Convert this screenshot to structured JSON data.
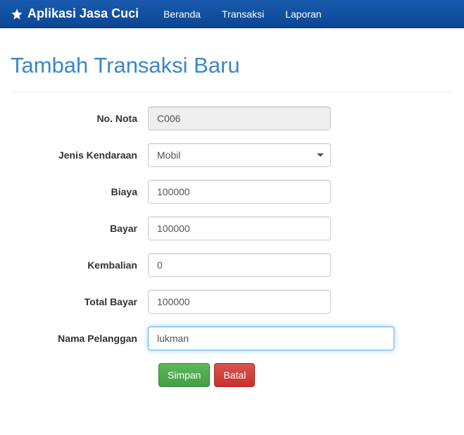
{
  "navbar": {
    "brand": "Aplikasi Jasa Cuci",
    "links": {
      "beranda": "Beranda",
      "transaksi": "Transaksi",
      "laporan": "Laporan"
    }
  },
  "page": {
    "title": "Tambah Transaksi Baru"
  },
  "form": {
    "labels": {
      "no_nota": "No. Nota",
      "jenis_kendaraan": "Jenis Kendaraan",
      "biaya": "Biaya",
      "bayar": "Bayar",
      "kembalian": "Kembalian",
      "total_bayar": "Total Bayar",
      "nama_pelanggan": "Nama Pelanggan"
    },
    "values": {
      "no_nota": "C006",
      "jenis_kendaraan": "Mobil",
      "biaya": "100000",
      "bayar": "100000",
      "kembalian": "0",
      "total_bayar": "100000",
      "nama_pelanggan": "lukman"
    },
    "buttons": {
      "simpan": "Simpan",
      "batal": "Batal"
    }
  }
}
